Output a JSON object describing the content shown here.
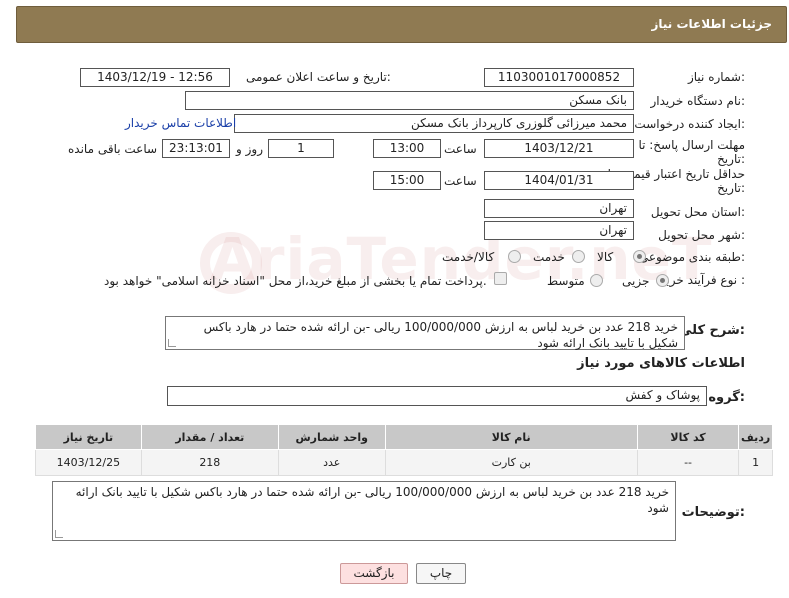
{
  "header": {
    "title": "جزئیات اطلاعات نیاز"
  },
  "fields": {
    "need_number_label": "شماره نیاز:",
    "need_number": "1103001017000852",
    "announce_label": "تاریخ و ساعت اعلان عمومی:",
    "announce_value": "1403/12/19 - 12:56",
    "buyer_org_label": "نام دستگاه خریدار:",
    "buyer_org": "بانک مسکن",
    "creator_label": "ایجاد کننده درخواست:",
    "creator": "محمد میرزائی گلوزری کارپرداز بانک مسکن",
    "contact_link": "اطلاعات تماس خریدار",
    "deadline_label_1": "مهلت ارسال پاسخ: تا",
    "deadline_label_2": "تاریخ:",
    "deadline_date": "1403/12/21",
    "time_label": "ساعت",
    "deadline_time": "13:00",
    "days_value": "1",
    "days_label": "روز و",
    "remaining_time": "23:13:01",
    "remaining_label": "ساعت باقی مانده",
    "validity_label_1": "حداقل تاریخ اعتبار قیمت: تا",
    "validity_label_2": "تاریخ:",
    "validity_date": "1404/01/31",
    "validity_time": "15:00",
    "province_label": "استان محل تحویل:",
    "province": "تهران",
    "city_label": "شهر محل تحویل:",
    "city": "تهران",
    "category_label": "طبقه بندی موضوعی:",
    "cat_goods": "کالا",
    "cat_service": "خدمت",
    "cat_goods_service": "کالا/خدمت",
    "purchase_type_label": "نوع فرآیند خرید :",
    "pt_partial": "جزیی",
    "pt_medium": "متوسط",
    "payment_note": "پرداخت تمام یا بخشی از مبلغ خرید،از محل \"اسناد خزانه اسلامی\" خواهد بود."
  },
  "description": {
    "label": "شرح کلی نیاز:",
    "text": "خرید 218 عدد بن خرید لباس به ارزش 100/000/000 ریالی -بن ارائه شده حتما در هارد باکس شکیل با تایید بانک ارائه شود"
  },
  "goods_info": {
    "title": "اطلاعات کالاهای مورد نیاز",
    "group_label": "گروه کالا:",
    "group_value": "پوشاک و کفش"
  },
  "table": {
    "headers": [
      "ردیف",
      "کد کالا",
      "نام کالا",
      "واحد شمارش",
      "تعداد / مقدار",
      "تاریخ نیاز"
    ],
    "rows": [
      [
        "1",
        "--",
        "بن کارت",
        "عدد",
        "218",
        "1403/12/25"
      ]
    ]
  },
  "buyer_notes": {
    "label": "توضیحات خریدار:",
    "text": "خرید 218 عدد بن خرید لباس به ارزش 100/000/000 ریالی -بن ارائه شده حتما در هارد باکس شکیل با تایید بانک ارائه شود"
  },
  "buttons": {
    "print": "چاپ",
    "back": "بازگشت"
  },
  "watermark": "AriaTender.neT"
}
